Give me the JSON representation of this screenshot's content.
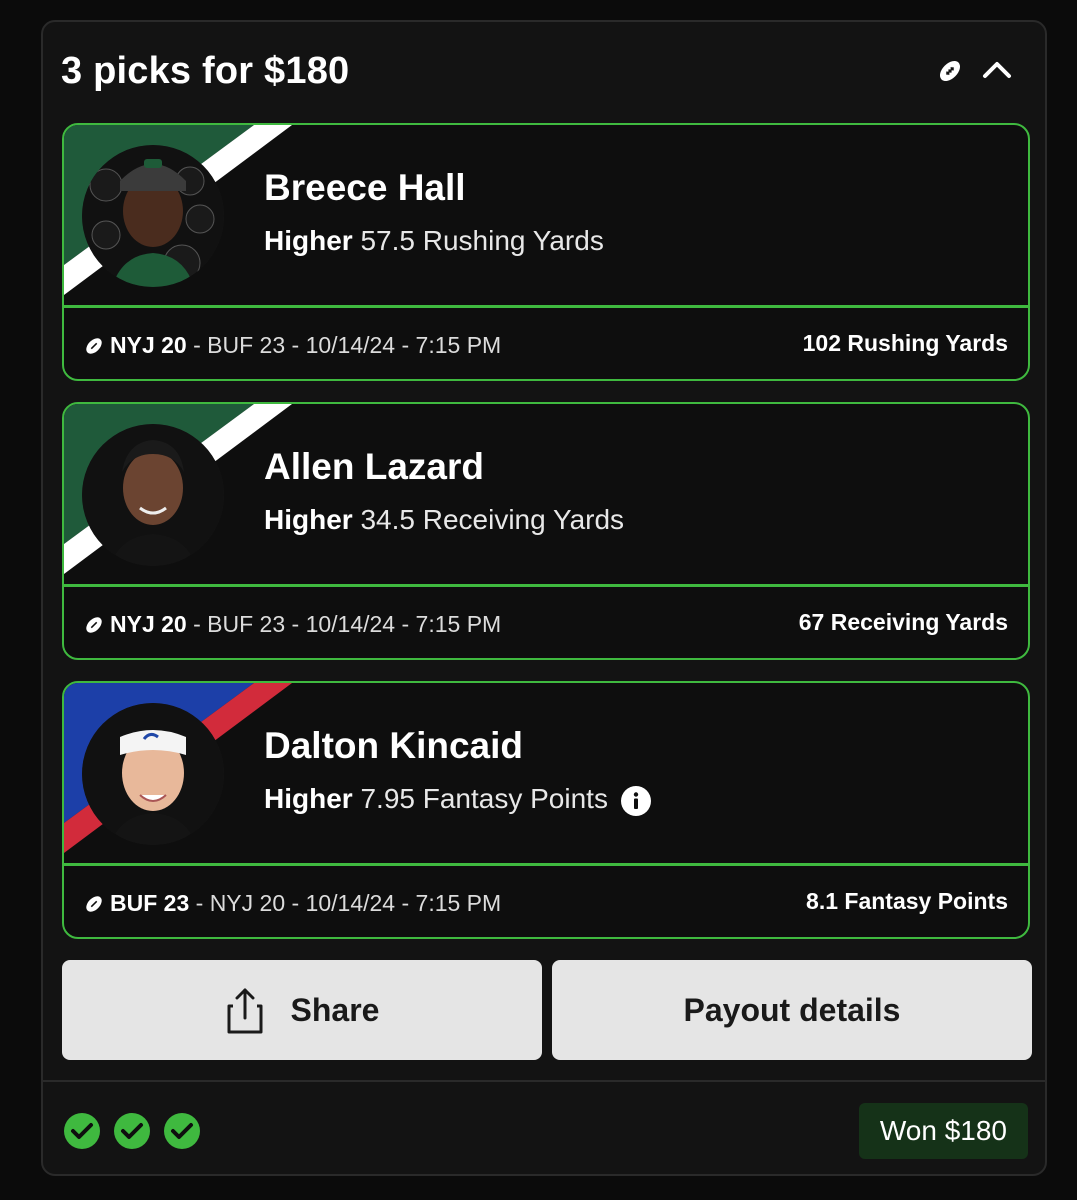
{
  "header": {
    "title": "3 picks for $180",
    "sport_icon": "football-icon",
    "collapse_icon": "chevron-up-icon"
  },
  "picks": [
    {
      "player": "Breece Hall",
      "direction": "Higher",
      "line": "57.5 Rushing Yards",
      "team": "NYJ 20",
      "game_rest": "- BUF 23 - 10/14/24 - 7:15 PM",
      "result": "102 Rushing Yards",
      "team_colors": [
        "#1f5a3a",
        "#ffffff"
      ]
    },
    {
      "player": "Allen Lazard",
      "direction": "Higher",
      "line": "34.5 Receiving Yards",
      "team": "NYJ 20",
      "game_rest": "- BUF 23 - 10/14/24 - 7:15 PM",
      "result": "67 Receiving Yards",
      "team_colors": [
        "#1f5a3a",
        "#ffffff"
      ]
    },
    {
      "player": "Dalton Kincaid",
      "direction": "Higher",
      "line": "7.95 Fantasy Points",
      "team": "BUF 23",
      "game_rest": "- NYJ 20 - 10/14/24 - 7:15 PM",
      "result": "8.1 Fantasy Points",
      "team_colors": [
        "#1c3fa8",
        "#d22b3b"
      ]
    }
  ],
  "buttons": {
    "share": "Share",
    "payout": "Payout details"
  },
  "footer": {
    "checks": 3,
    "won_label": "Won $180"
  },
  "colors": {
    "accent_green": "#3fb93f",
    "won_bg": "#153218"
  }
}
